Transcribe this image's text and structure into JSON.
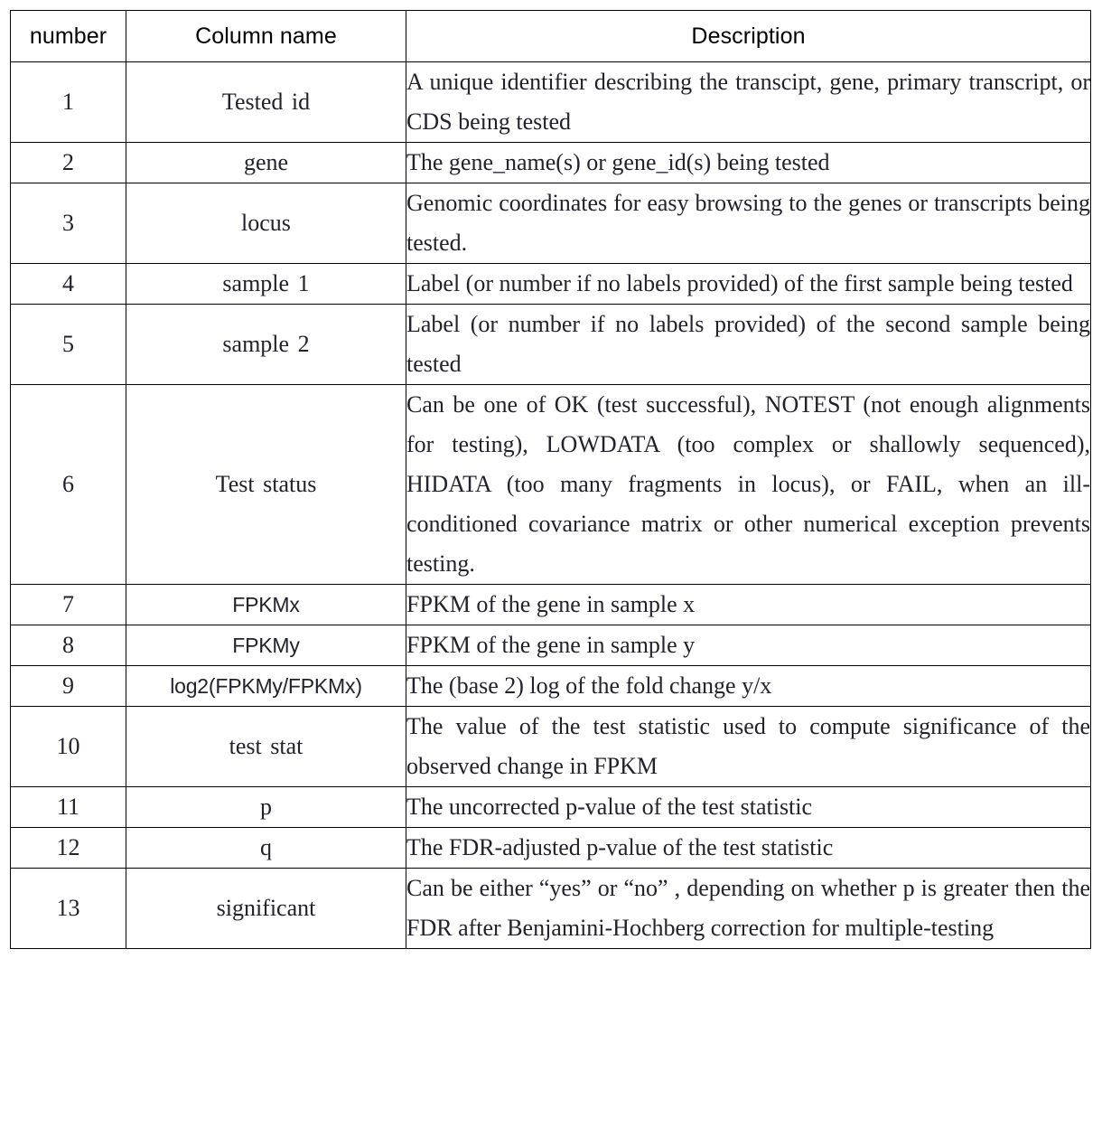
{
  "table": {
    "headers": {
      "number": "number",
      "column_name": "Column name",
      "description": "Description"
    },
    "rows": [
      {
        "number": "1",
        "column_name": "Tested id",
        "name_font": "serif",
        "description": "A unique identifier describing the transcipt, gene, primary transcript, or CDS being tested",
        "lines": 2
      },
      {
        "number": "2",
        "column_name": "gene",
        "name_font": "serif",
        "description": "The gene_name(s) or gene_id(s) being tested",
        "lines": 1
      },
      {
        "number": "3",
        "column_name": "locus",
        "name_font": "serif",
        "description": "Genomic coordinates for easy browsing to the genes or transcripts being tested.",
        "lines": 2
      },
      {
        "number": "4",
        "column_name": "sample 1",
        "name_font": "serif",
        "description": "Label (or number if no labels provided) of the first sample being tested",
        "lines": 2
      },
      {
        "number": "5",
        "column_name": "sample 2",
        "name_font": "serif",
        "description": "Label (or number if no labels provided) of the second sample being tested",
        "lines": 2
      },
      {
        "number": "6",
        "column_name": "Test status",
        "name_font": "serif",
        "description": "Can be one of OK (test successful), NOTEST (not enough alignments for testing), LOWDATA (too complex or shallowly sequenced), HIDATA (too many fragments in locus), or FAIL, when an ill-conditioned covariance matrix or other numerical exception prevents testing.",
        "lines": 6
      },
      {
        "number": "7",
        "column_name": "FPKMx",
        "name_font": "sans",
        "description": "FPKM of the gene in sample x",
        "lines": 1
      },
      {
        "number": "8",
        "column_name": "FPKMy",
        "name_font": "sans",
        "description": "FPKM of the gene in sample y",
        "lines": 1
      },
      {
        "number": "9",
        "column_name": "log2(FPKMy/FPKMx)",
        "name_font": "sans",
        "description": "The (base 2) log of the fold change y/x",
        "lines": 1
      },
      {
        "number": "10",
        "column_name": "test stat",
        "name_font": "serif",
        "description": "The value of the test statistic used to compute significance of the observed change in FPKM",
        "lines": 2
      },
      {
        "number": "11",
        "column_name": "p",
        "name_font": "serif",
        "description": "The uncorrected p-value of the test statistic",
        "lines": 1
      },
      {
        "number": "12",
        "column_name": "q",
        "name_font": "serif",
        "description": "The FDR-adjusted p-value of the test statistic",
        "lines": 1
      },
      {
        "number": "13",
        "column_name": "significant",
        "name_font": "serif",
        "description": "Can be either “yes” or “no” , depending on whether p is greater then the FDR after Benjamini-Hochberg correction for multiple-testing",
        "lines": 3
      }
    ]
  },
  "style": {
    "border_color": "#000000",
    "text_color": "#22222c",
    "background": "#ffffff"
  }
}
